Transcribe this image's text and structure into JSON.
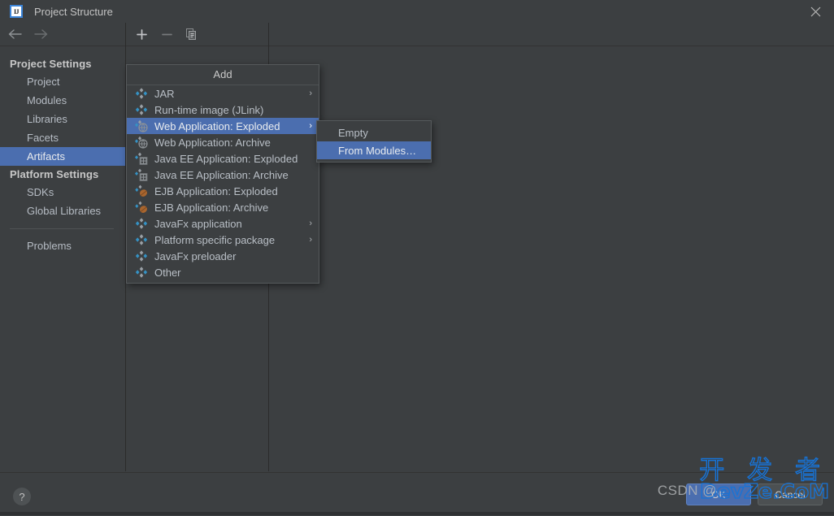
{
  "window": {
    "title": "Project Structure",
    "app_icon_label": "IJ",
    "close_icon": "close-icon"
  },
  "nav": {
    "back_label": "←",
    "forward_label": "→"
  },
  "toolbar": {
    "add_label": "+",
    "remove_label": "−",
    "copy_label": "copy-icon"
  },
  "sidebar": {
    "groups": [
      {
        "title": "Project Settings",
        "items": [
          {
            "label": "Project",
            "selected": false
          },
          {
            "label": "Modules",
            "selected": false
          },
          {
            "label": "Libraries",
            "selected": false
          },
          {
            "label": "Facets",
            "selected": false
          },
          {
            "label": "Artifacts",
            "selected": true
          }
        ]
      },
      {
        "title": "Platform Settings",
        "items": [
          {
            "label": "SDKs",
            "selected": false
          },
          {
            "label": "Global Libraries",
            "selected": false
          }
        ]
      }
    ],
    "problems": {
      "label": "Problems",
      "selected": false
    }
  },
  "popup": {
    "title": "Add",
    "items": [
      {
        "label": "JAR",
        "icon": "artifact-icon",
        "has_submenu": true,
        "highlight": false
      },
      {
        "label": "Run-time image (JLink)",
        "icon": "artifact-icon",
        "has_submenu": false,
        "highlight": false
      },
      {
        "label": "Web Application: Exploded",
        "icon": "web-exploded-icon",
        "has_submenu": true,
        "highlight": true
      },
      {
        "label": "Web Application: Archive",
        "icon": "web-archive-icon",
        "has_submenu": false,
        "highlight": false
      },
      {
        "label": "Java EE Application: Exploded",
        "icon": "javaee-exploded-icon",
        "has_submenu": false,
        "highlight": false
      },
      {
        "label": "Java EE Application: Archive",
        "icon": "javaee-archive-icon",
        "has_submenu": false,
        "highlight": false
      },
      {
        "label": "EJB Application: Exploded",
        "icon": "ejb-exploded-icon",
        "has_submenu": false,
        "highlight": false
      },
      {
        "label": "EJB Application: Archive",
        "icon": "ejb-archive-icon",
        "has_submenu": false,
        "highlight": false
      },
      {
        "label": "JavaFx application",
        "icon": "artifact-icon",
        "has_submenu": true,
        "highlight": false
      },
      {
        "label": "Platform specific package",
        "icon": "artifact-icon",
        "has_submenu": true,
        "highlight": false
      },
      {
        "label": "JavaFx preloader",
        "icon": "artifact-icon",
        "has_submenu": false,
        "highlight": false
      },
      {
        "label": "Other",
        "icon": "artifact-icon",
        "has_submenu": false,
        "highlight": false
      }
    ],
    "submenu_arrow": "›"
  },
  "submenu": {
    "items": [
      {
        "label": "Empty",
        "highlight": false
      },
      {
        "label": "From Modules…",
        "highlight": true
      }
    ]
  },
  "footer": {
    "help_label": "?",
    "ok_label": "OK",
    "cancel_label": "Cancel"
  },
  "watermark": {
    "chinese": "开 发 者",
    "english": "DevZe.CoM",
    "credit": "CSDN @"
  },
  "colors": {
    "accent_selection": "#4b6eaf",
    "background": "#3c3f41",
    "border": "#565a5c",
    "text": "#b9bfc6",
    "watermark": "#1773d6"
  }
}
